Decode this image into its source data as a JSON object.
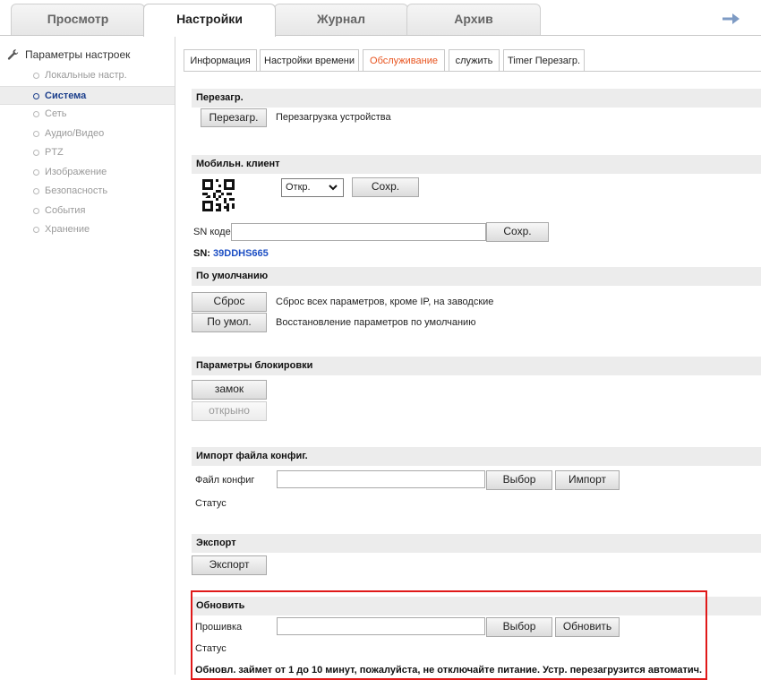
{
  "top_tabs": [
    {
      "label": "Просмотр"
    },
    {
      "label": "Настройки"
    },
    {
      "label": "Журнал"
    },
    {
      "label": "Архив"
    }
  ],
  "sidebar": {
    "title": "Параметры настроек",
    "items": [
      {
        "label": "Локальные настр."
      },
      {
        "label": "Система"
      },
      {
        "label": "Сеть"
      },
      {
        "label": "Аудио/Видео"
      },
      {
        "label": "PTZ"
      },
      {
        "label": "Изображение"
      },
      {
        "label": "Безопасность"
      },
      {
        "label": "События"
      },
      {
        "label": "Хранение"
      }
    ]
  },
  "sub_tabs": [
    {
      "label": "Информация"
    },
    {
      "label": "Настройки времени"
    },
    {
      "label": "Обслуживание"
    },
    {
      "label": "служить"
    },
    {
      "label": "Timer Перезагр."
    }
  ],
  "reboot": {
    "title": "Перезагр.",
    "button": "Перезагр.",
    "description": "Перезагрузка устройства"
  },
  "mobile": {
    "title": "Мобильн. клиент",
    "select_value": "Откр.",
    "save_button": "Сохр.",
    "sn_code_label": "SN кодекс",
    "sn_code_value": "",
    "sn_save_button": "Сохр.",
    "sn_label": "SN:",
    "sn_value": "39DDHS665"
  },
  "defaults": {
    "title": "По умолчанию",
    "reset_button": "Сброс",
    "reset_description": "Сброс всех параметров, кроме IP, на заводские",
    "default_button": "По умол.",
    "default_description": "Восстановление параметров по умолчанию"
  },
  "lock": {
    "title": "Параметры блокировки",
    "lock_button": "замок",
    "unlock_button": "открыно"
  },
  "import": {
    "title": "Импорт файла конфиг.",
    "file_label": "Файл конфиг",
    "file_value": "",
    "browse_button": "Выбор",
    "import_button": "Импорт",
    "status_label": "Статус"
  },
  "export": {
    "title": "Экспорт",
    "button": "Экспорт"
  },
  "upgrade": {
    "title": "Обновить",
    "firmware_label": "Прошивка",
    "firmware_value": "",
    "browse_button": "Выбор",
    "upgrade_button": "Обновить",
    "status_label": "Статус",
    "warning": "Обновл. займет от 1 до 10 минут, пожалуйста, не отключайте питание. Устр. перезагрузится автоматич."
  },
  "colors": {
    "active_subtab": "#e8541f",
    "sidebar_active": "#1c3f8c",
    "sn_value": "#1d4fc4",
    "highlight_border": "#e01919"
  }
}
